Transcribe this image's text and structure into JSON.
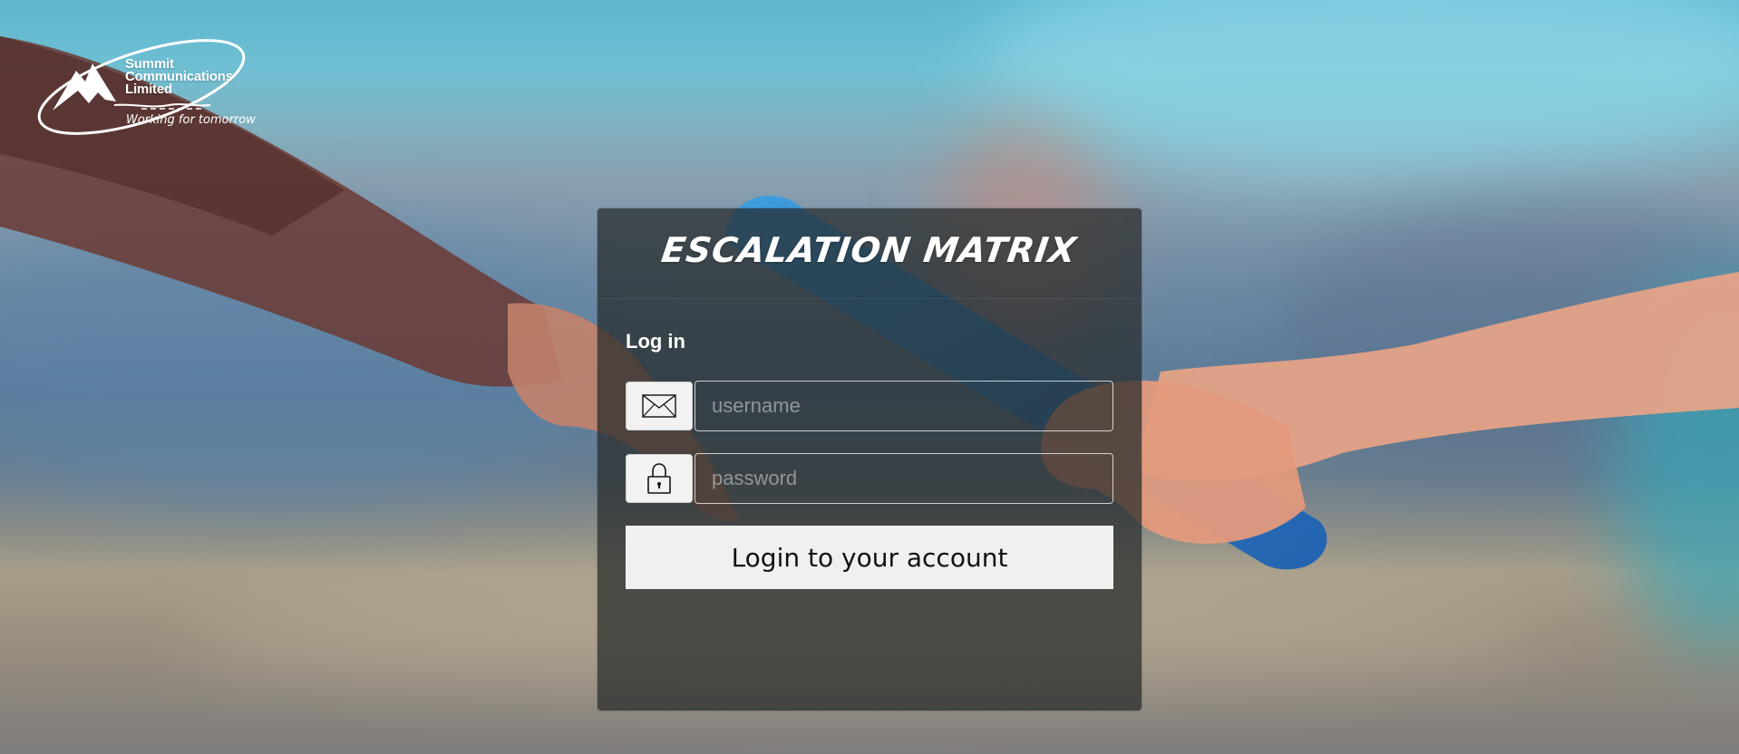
{
  "brand": {
    "line1": "Summit",
    "line2": "Communications",
    "line3": "Limited",
    "tagline": "Working for tomorrow"
  },
  "app": {
    "title": "ESCALATION MATRIX"
  },
  "login": {
    "heading": "Log in",
    "username_placeholder": "username",
    "password_placeholder": "password",
    "submit_label": "Login to your account"
  },
  "icons": {
    "username": "envelope-icon",
    "password": "padlock-icon"
  }
}
